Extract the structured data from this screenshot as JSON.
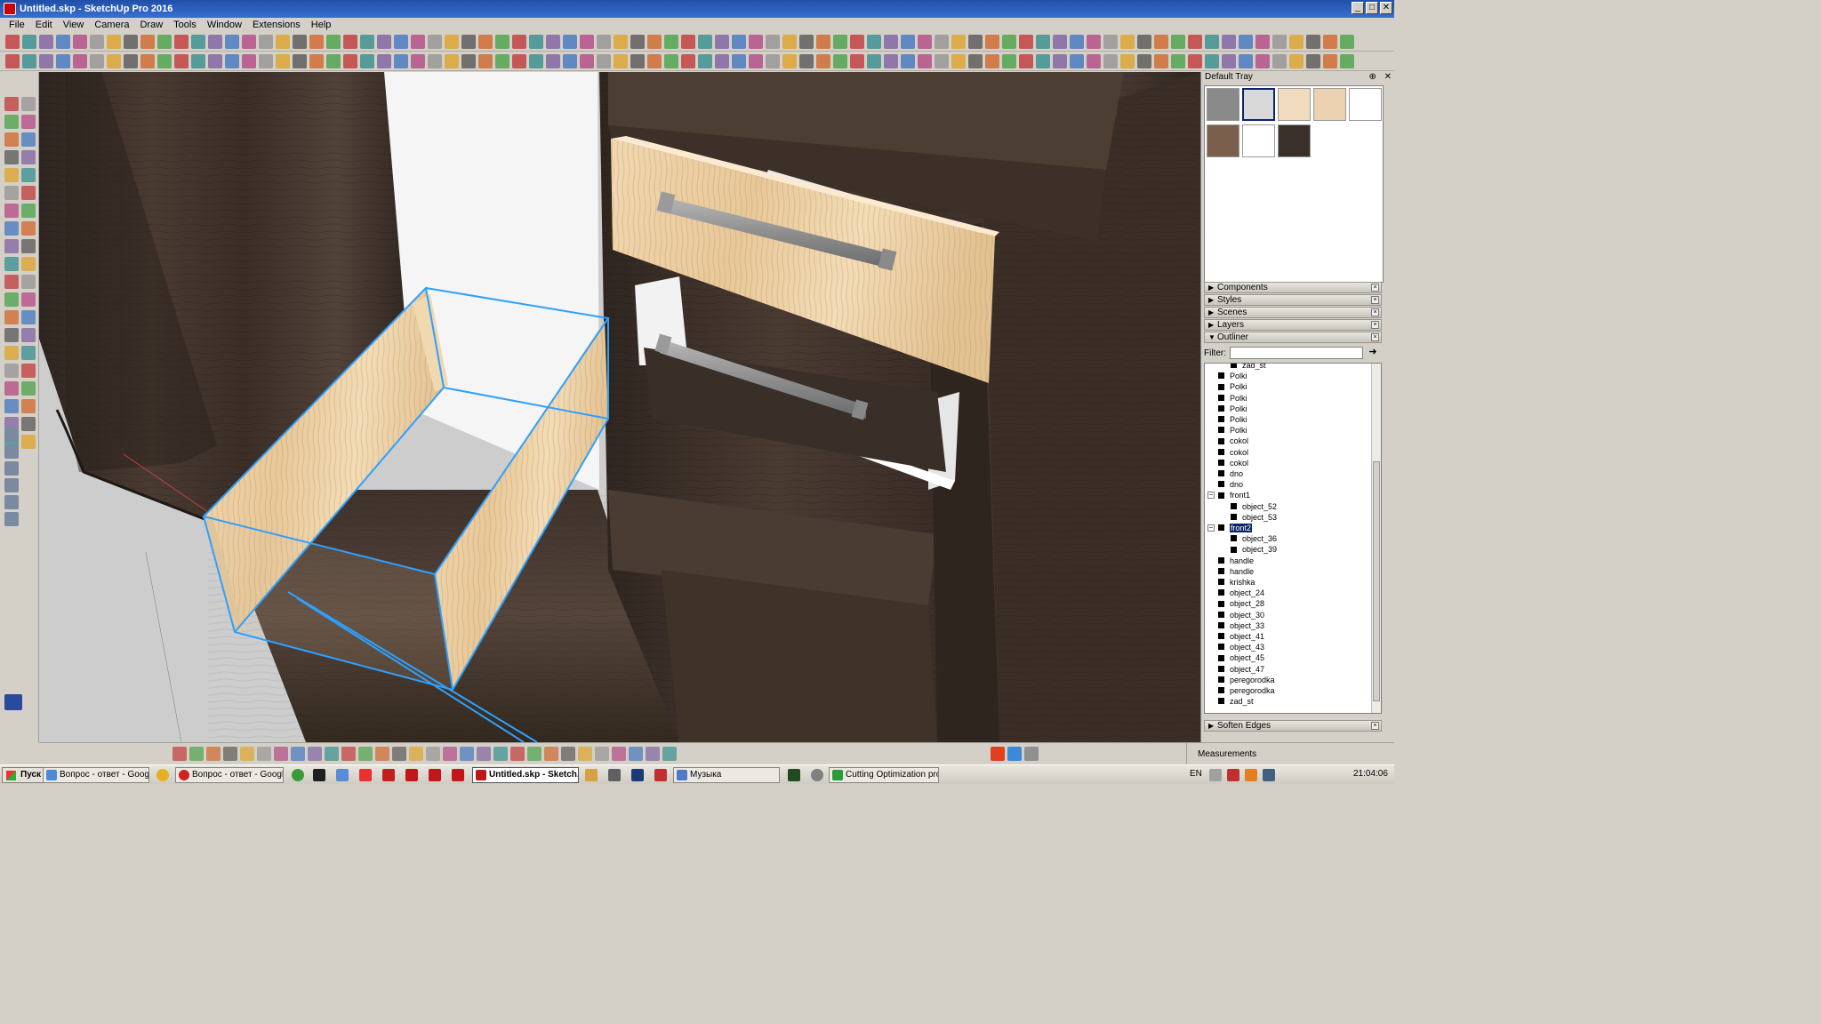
{
  "window": {
    "title": "Untitled.skp - SketchUp Pro 2016",
    "buttons": [
      "_",
      "□",
      "✕"
    ]
  },
  "menu": [
    "File",
    "Edit",
    "View",
    "Camera",
    "Draw",
    "Tools",
    "Window",
    "Extensions",
    "Help"
  ],
  "tray": {
    "title": "Default Tray",
    "pin": "⊕",
    "close": "✕",
    "materials": [
      {
        "name": "gray",
        "color": "#8a8a8a"
      },
      {
        "name": "marble",
        "color": "#d9d9d9"
      },
      {
        "name": "light-wood-1",
        "color": "#f2dcc0"
      },
      {
        "name": "light-wood-2",
        "color": "#ecd2b0"
      },
      {
        "name": "white",
        "color": "#ffffff"
      },
      {
        "name": "dark-stone",
        "color": "#7a5f4c"
      },
      {
        "name": "white-2",
        "color": "#ffffff"
      },
      {
        "name": "dark-wood",
        "color": "#3a302a"
      }
    ],
    "panels": [
      {
        "label": "Components",
        "state": "collapsed"
      },
      {
        "label": "Styles",
        "state": "collapsed"
      },
      {
        "label": "Scenes",
        "state": "collapsed"
      },
      {
        "label": "Layers",
        "state": "collapsed"
      },
      {
        "label": "Outliner",
        "state": "expanded"
      }
    ],
    "filter_label": "Filter:",
    "filter_value": "",
    "soften_edges": "Soften Edges"
  },
  "outliner": {
    "selected": "front2",
    "rows": [
      {
        "label": "zad_st",
        "indent": 1
      },
      {
        "label": "Polki",
        "indent": 0
      },
      {
        "label": "Polki",
        "indent": 0
      },
      {
        "label": "Polki",
        "indent": 0
      },
      {
        "label": "Polki",
        "indent": 0
      },
      {
        "label": "Polki",
        "indent": 0
      },
      {
        "label": "Polki",
        "indent": 0
      },
      {
        "label": "cokol",
        "indent": 0
      },
      {
        "label": "cokol",
        "indent": 0
      },
      {
        "label": "cokol",
        "indent": 0
      },
      {
        "label": "dno",
        "indent": 0
      },
      {
        "label": "dno",
        "indent": 0
      },
      {
        "label": "front1",
        "indent": 0,
        "expander": "−"
      },
      {
        "label": "object_52",
        "indent": 1
      },
      {
        "label": "object_53",
        "indent": 1
      },
      {
        "label": "front2",
        "indent": 0,
        "expander": "−",
        "selected": true
      },
      {
        "label": "object_36",
        "indent": 1
      },
      {
        "label": "object_39",
        "indent": 1
      },
      {
        "label": "handle",
        "indent": 0
      },
      {
        "label": "handle",
        "indent": 0
      },
      {
        "label": "krishka",
        "indent": 0
      },
      {
        "label": "object_24",
        "indent": 0
      },
      {
        "label": "object_28",
        "indent": 0
      },
      {
        "label": "object_30",
        "indent": 0
      },
      {
        "label": "object_33",
        "indent": 0
      },
      {
        "label": "object_41",
        "indent": 0
      },
      {
        "label": "object_43",
        "indent": 0
      },
      {
        "label": "object_45",
        "indent": 0
      },
      {
        "label": "object_47",
        "indent": 0
      },
      {
        "label": "peregorodka",
        "indent": 0
      },
      {
        "label": "peregorodka",
        "indent": 0
      },
      {
        "label": "zad_st",
        "indent": 0
      }
    ]
  },
  "status": {
    "measurements_label": "Measurements"
  },
  "taskbar": {
    "start": "Пуск",
    "tasks": [
      {
        "label": "Вопрос - ответ - Google...",
        "icon_color": "#4a8ad8",
        "active": false
      },
      {
        "label": "Вопрос - ответ - Google...",
        "icon_color": "#d02020",
        "active": false
      },
      {
        "label": "Untitled.skp - Sketch...",
        "icon_color": "#c01818",
        "active": true
      },
      {
        "label": "Музыка",
        "icon_color": "#4a7ac8",
        "active": false
      },
      {
        "label": "Cutting Optimization pro ...",
        "icon_color": "#2a9a3a",
        "active": false
      }
    ],
    "lang": "EN",
    "clock": "21:04:06"
  },
  "colors": {
    "title_bar": "#2a5cc0",
    "selection_blue": "#2ea0ff",
    "dark_wood": "#3b2f28",
    "light_wood": "#ecd0a4"
  }
}
